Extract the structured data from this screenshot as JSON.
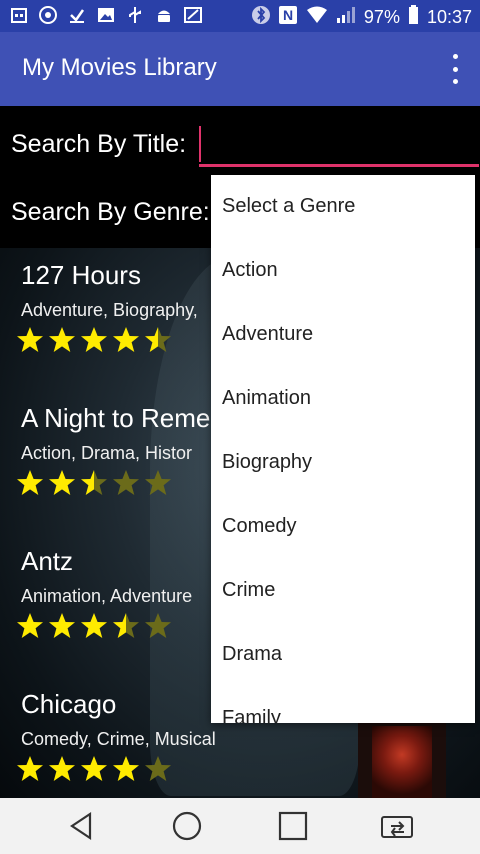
{
  "status_bar": {
    "battery": "97%",
    "time": "10:37",
    "icons_left": [
      "calendar-icon",
      "chrome-icon",
      "download-icon",
      "image-icon",
      "usb-icon",
      "android-icon",
      "map-icon"
    ],
    "icons_right": [
      "bluetooth-icon",
      "nfc-icon",
      "wifi-icon",
      "signal-icon",
      "battery-icon"
    ]
  },
  "app_bar": {
    "title": "My Movies Library"
  },
  "search": {
    "title_label": "Search By Title:",
    "title_value": "",
    "genre_label": "Search By Genre:"
  },
  "movies": [
    {
      "title": "127 Hours",
      "genres": "Adventure, Biography,",
      "rating": 4.5
    },
    {
      "title": "A Night to Reme",
      "genres": "Action, Drama, Histor",
      "rating": 2.5
    },
    {
      "title": "Antz",
      "genres": "Animation, Adventure",
      "rating": 3.5
    },
    {
      "title": "Chicago",
      "genres": "Comedy, Crime, Musical",
      "rating": 4
    }
  ],
  "genre_dropdown": {
    "options": [
      "Select a Genre",
      "Action",
      "Adventure",
      "Animation",
      "Biography",
      "Comedy",
      "Crime",
      "Drama",
      "Family"
    ]
  },
  "colors": {
    "app_bar": "#3f51b5",
    "status_bar": "#2a40a8",
    "accent": "#e0336b",
    "star_filled": "#ffeb00",
    "star_empty": "#6b6b1a"
  },
  "nav_bar": {
    "icons": [
      "back-icon",
      "home-icon",
      "recents-icon",
      "screen-share-icon"
    ]
  }
}
